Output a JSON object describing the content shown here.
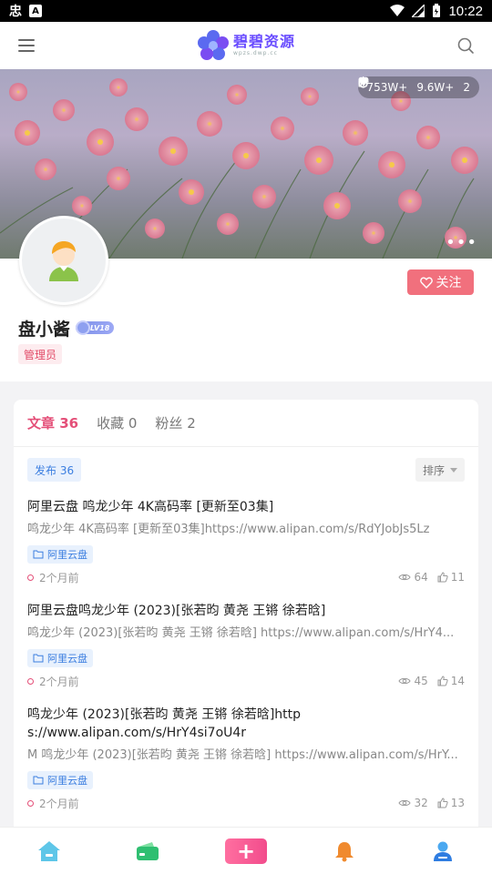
{
  "status_bar": {
    "time": "10:22"
  },
  "header": {
    "logo_text": "碧碧资源",
    "logo_sub": "wpzs.dwp.cc"
  },
  "banner": {
    "stats": {
      "views": "753W+",
      "likes": "9.6W+",
      "hearts": "2"
    }
  },
  "profile": {
    "follow_label": "关注",
    "username": "盘小酱",
    "level": "LV18",
    "role": "管理员"
  },
  "tabs": [
    {
      "label": "文章 36"
    },
    {
      "label": "收藏 0"
    },
    {
      "label": "粉丝 2"
    }
  ],
  "filters": {
    "publish": "发布 36",
    "sort": "排序"
  },
  "articles": [
    {
      "title": "阿里云盘 鸣龙少年 4K高码率 [更新至03集]",
      "excerpt": "鸣龙少年 4K高码率 [更新至03集]https://www.alipan.com/s/RdYJobJs5Lz",
      "category": "阿里云盘",
      "time": "2个月前",
      "views": "64",
      "likes": "11"
    },
    {
      "title": "阿里云盘鸣龙少年 (2023)[张若昀 黄尧 王锵 徐若晗]",
      "excerpt": " 鸣龙少年 (2023)[张若昀 黄尧 王锵 徐若晗] https://www.alipan.com/s/HrY4...",
      "category": "阿里云盘",
      "time": "2个月前",
      "views": "45",
      "likes": "14"
    },
    {
      "title": "鸣龙少年 (2023)[张若昀 黄尧 王锵 徐若晗]https://www.alipan.com/s/HrY4si7oU4r",
      "excerpt": "M 鸣龙少年 (2023)[张若昀 黄尧 王锵 徐若晗] https://www.alipan.com/s/HrY...",
      "category": "阿里云盘",
      "time": "2个月前",
      "views": "32",
      "likes": "13"
    }
  ]
}
